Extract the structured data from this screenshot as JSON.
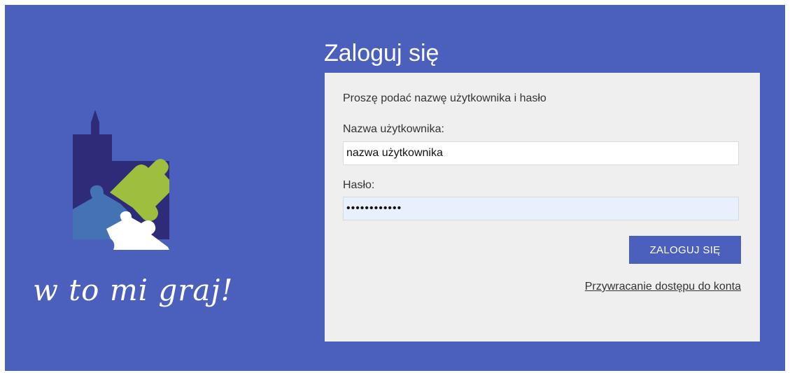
{
  "brand": {
    "tagline": "w to mi graj!",
    "colors": {
      "background": "#4b5fbd",
      "tower": "#2e2b79",
      "puzzle_green": "#9dbf3d",
      "puzzle_blue": "#4472b4",
      "puzzle_white": "#ffffff"
    },
    "logo_icon": "puzzle-tower-logo"
  },
  "login": {
    "title": "Zaloguj się",
    "instructions": "Proszę podać nazwę użytkownika i hasło",
    "username_label": "Nazwa użytkownika:",
    "username_value": "nazwa użytkownika",
    "password_label": "Hasło:",
    "password_value": "••••••••••••",
    "submit_label": "ZALOGUJ SIĘ",
    "recover_link": "Przywracanie dostępu do konta"
  }
}
